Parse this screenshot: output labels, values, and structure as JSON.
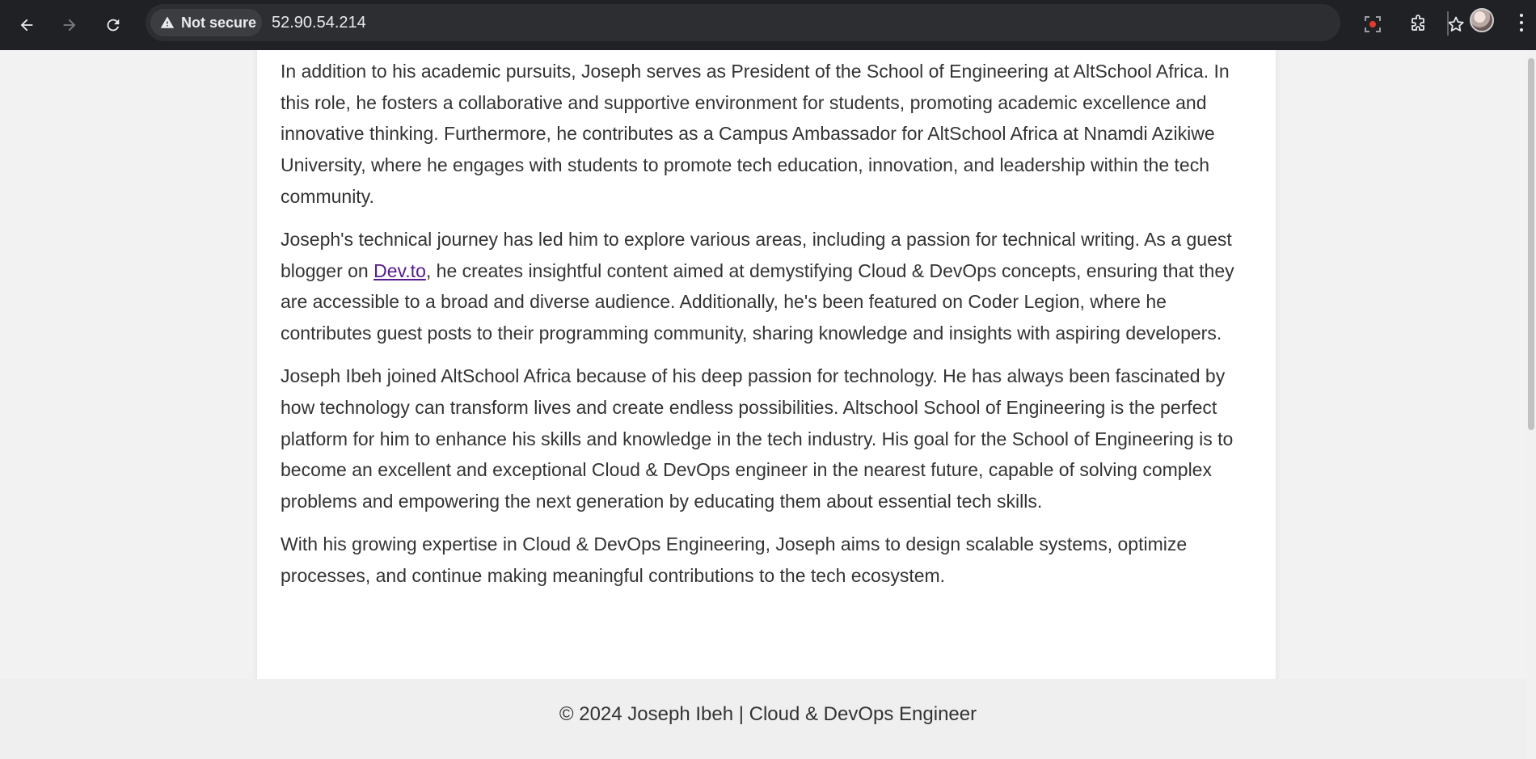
{
  "browser": {
    "security_label": "Not secure",
    "url": "52.90.54.214"
  },
  "article": {
    "p1": "In addition to his academic pursuits, Joseph serves as President of the School of Engineering at AltSchool Africa. In this role, he fosters a collaborative and supportive environment for students, promoting academic excellence and innovative thinking. Furthermore, he contributes as a Campus Ambassador for AltSchool Africa at Nnamdi Azikiwe University, where he engages with students to promote tech education, innovation, and leadership within the tech community.",
    "p2_before": "Joseph's technical journey has led him to explore various areas, including a passion for technical writing. As a guest blogger on ",
    "p2_link": "Dev.to",
    "p2_after": ", he creates insightful content aimed at demystifying Cloud & DevOps concepts, ensuring that they are accessible to a broad and diverse audience. Additionally, he's been featured on Coder Legion, where he contributes guest posts to their programming community, sharing knowledge and insights with aspiring developers.",
    "p3": "Joseph Ibeh joined AltSchool Africa because of his deep passion for technology. He has always been fascinated by how technology can transform lives and create endless possibilities. Altschool School of Engineering is the perfect platform for him to enhance his skills and knowledge in the tech industry. His goal for the School of Engineering is to become an excellent and exceptional Cloud & DevOps engineer in the nearest future, capable of solving complex problems and empowering the next generation by educating them about essential tech skills.",
    "p4": "With his growing expertise in Cloud & DevOps Engineering, Joseph aims to design scalable systems, optimize processes, and continue making meaningful contributions to the tech ecosystem."
  },
  "footer": {
    "text": "© 2024 Joseph Ibeh | Cloud & DevOps Engineer"
  },
  "colors": {
    "toolbar": "#202124",
    "link": "#551a8b",
    "text": "#333333"
  }
}
